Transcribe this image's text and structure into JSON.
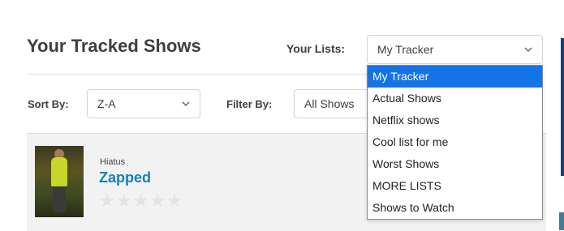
{
  "header": {
    "title": "Your Tracked Shows",
    "lists_label": "Your Lists:"
  },
  "lists_select": {
    "value": "My Tracker",
    "options": [
      "My Tracker",
      "Actual Shows",
      "Netflix shows",
      "Cool list for me",
      "Worst Shows",
      "MORE LISTS",
      "Shows to Watch"
    ],
    "selected_index": 0
  },
  "sort": {
    "label": "Sort By:",
    "value": "Z-A"
  },
  "filter": {
    "label": "Filter By:",
    "value": "All Shows"
  },
  "shows": [
    {
      "status": "Hiatus",
      "title": "Zapped",
      "rating_stars": 0,
      "max_stars": 5
    }
  ],
  "colors": {
    "accent": "#1473e6",
    "title_link": "#1580b8",
    "side_bar": "#1b3d78"
  },
  "icons": {
    "chevron": "chevron-down-icon",
    "star": "star-icon"
  }
}
